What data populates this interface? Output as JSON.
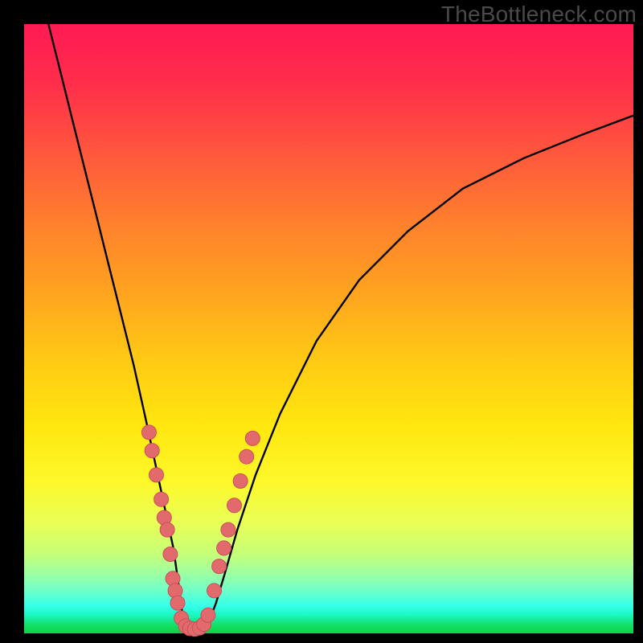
{
  "watermark": "TheBottleneck.com",
  "colors": {
    "frame": "#000000",
    "curve": "#000000",
    "dot_fill": "#e26a6d",
    "dot_stroke": "#c94f57",
    "gradient_stops": [
      "#ff1a54",
      "#ff2f4a",
      "#ff5a3c",
      "#ff7e2e",
      "#ffa31f",
      "#ffc914",
      "#ffe70f",
      "#fdf82a",
      "#e8ff57",
      "#c5ff78",
      "#a0ffa0",
      "#6effc9",
      "#35ffe9",
      "#1bf7c1",
      "#14e06e",
      "#0fd33c"
    ]
  },
  "chart_data": {
    "type": "line",
    "title": "",
    "xlabel": "",
    "ylabel": "",
    "xlim": [
      0,
      100
    ],
    "ylim": [
      0,
      100
    ],
    "grid": false,
    "legend": false,
    "series": [
      {
        "name": "bottleneck-curve",
        "x": [
          4,
          6,
          8,
          10,
          12,
          14,
          16,
          18,
          20,
          21.5,
          23,
          24.5,
          25.5,
          26,
          27,
          28,
          29,
          30,
          31.5,
          33,
          35,
          38,
          42,
          48,
          55,
          63,
          72,
          82,
          92,
          100
        ],
        "y": [
          100,
          92,
          84,
          76,
          68,
          60,
          52,
          44,
          35,
          28,
          21,
          14,
          7,
          3,
          1,
          0.5,
          0.5,
          1,
          5,
          10,
          17,
          26,
          36,
          48,
          58,
          66,
          73,
          78,
          82,
          85
        ]
      }
    ],
    "markers": {
      "name": "highlighted-points",
      "points": [
        {
          "x": 20.5,
          "y": 33
        },
        {
          "x": 21.0,
          "y": 30
        },
        {
          "x": 21.7,
          "y": 26
        },
        {
          "x": 22.5,
          "y": 22
        },
        {
          "x": 23.0,
          "y": 19
        },
        {
          "x": 23.5,
          "y": 17
        },
        {
          "x": 24.0,
          "y": 13
        },
        {
          "x": 24.4,
          "y": 9
        },
        {
          "x": 24.8,
          "y": 7
        },
        {
          "x": 25.2,
          "y": 5
        },
        {
          "x": 25.8,
          "y": 2.5
        },
        {
          "x": 26.5,
          "y": 1.2
        },
        {
          "x": 27.2,
          "y": 0.8
        },
        {
          "x": 28.0,
          "y": 0.7
        },
        {
          "x": 28.8,
          "y": 0.9
        },
        {
          "x": 29.5,
          "y": 1.5
        },
        {
          "x": 30.2,
          "y": 3
        },
        {
          "x": 31.2,
          "y": 7
        },
        {
          "x": 32.0,
          "y": 11
        },
        {
          "x": 32.8,
          "y": 14
        },
        {
          "x": 33.5,
          "y": 17
        },
        {
          "x": 34.5,
          "y": 21
        },
        {
          "x": 35.5,
          "y": 25
        },
        {
          "x": 36.5,
          "y": 29
        },
        {
          "x": 37.5,
          "y": 32
        }
      ]
    }
  }
}
